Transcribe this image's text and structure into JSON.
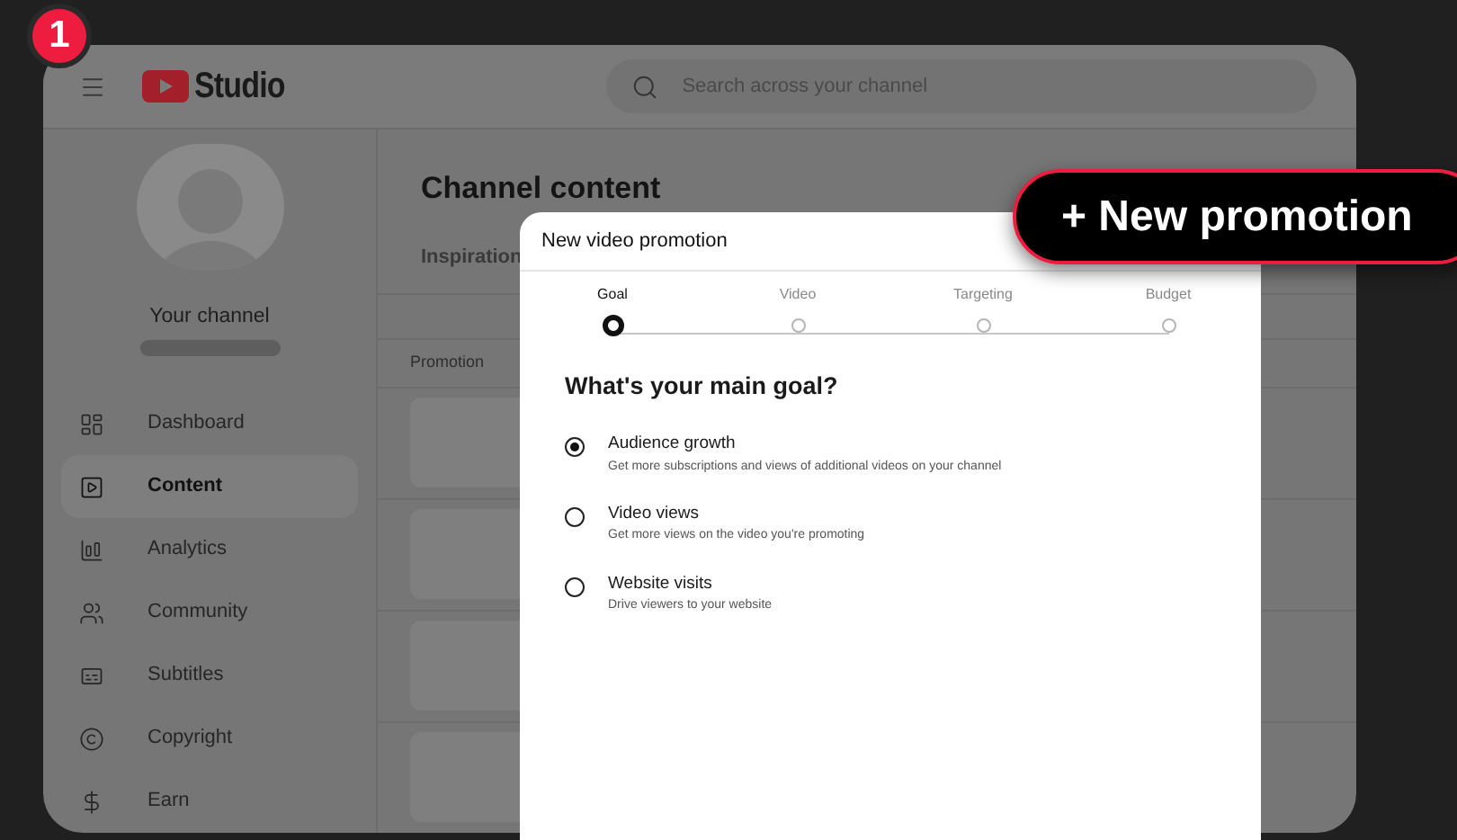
{
  "step_badge": "1",
  "header": {
    "logo_text": "Studio",
    "search": {
      "placeholder": "Search across your channel"
    }
  },
  "sidebar": {
    "channel_name": "Your channel",
    "items": [
      {
        "label": "Dashboard",
        "selected": false
      },
      {
        "label": "Content",
        "selected": true
      },
      {
        "label": "Analytics",
        "selected": false
      },
      {
        "label": "Community",
        "selected": false
      },
      {
        "label": "Subtitles",
        "selected": false
      },
      {
        "label": "Copyright",
        "selected": false
      },
      {
        "label": "Earn",
        "selected": false
      }
    ]
  },
  "content": {
    "title": "Channel content",
    "tabs": [
      {
        "label": "Inspiration",
        "selected": false
      }
    ],
    "table": {
      "columns": [
        "Promotion"
      ],
      "rows": [
        {
          "kind": "skeleton"
        },
        {
          "kind": "skeleton"
        },
        {
          "kind": "skeleton"
        },
        {
          "kind": "skeleton"
        }
      ]
    }
  },
  "dialog": {
    "title": "New video promotion",
    "steps": [
      {
        "label": "Goal",
        "selected": true
      },
      {
        "label": "Video",
        "selected": false
      },
      {
        "label": "Targeting",
        "selected": false
      },
      {
        "label": "Budget",
        "selected": false
      }
    ],
    "question": "What's your main goal?",
    "options": [
      {
        "title": "Audience growth",
        "description": "Get more subscriptions and views of additional videos on your channel",
        "selected": true
      },
      {
        "title": "Video views",
        "description": "Get more views on the video you're promoting",
        "selected": false
      },
      {
        "title": "Website visits",
        "description": "Drive viewers to your website",
        "selected": false
      }
    ]
  },
  "callout": {
    "label": "+ New promotion"
  }
}
